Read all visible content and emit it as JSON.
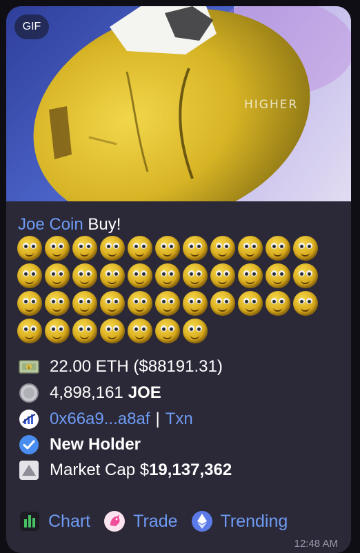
{
  "media": {
    "badge": "GIF",
    "overlay_text": "HIGHER"
  },
  "message": {
    "coin_name": "Joe Coin",
    "title_suffix": "Buy!",
    "emoji_rows": [
      11,
      11,
      11,
      7
    ],
    "emoji_icon": "nervous-smiley-icon",
    "lines": {
      "eth_amount": "22.00 ETH ($88191.31)",
      "token_amount": "4,898,161",
      "token_symbol": "JOE",
      "buyer_address": "0x66a9...a8af",
      "separator": "|",
      "txn_label": "Txn",
      "holder_status": "New Holder",
      "market_cap_label": "Market Cap $",
      "market_cap_value": "19,137,362"
    },
    "buttons": {
      "chart": "Chart",
      "trade": "Trade",
      "trending": "Trending"
    },
    "timestamp": "12:48 AM"
  },
  "colors": {
    "bubble": "#2b2937",
    "link": "#6e9bf4",
    "text": "#ffffff",
    "timestamp": "#9a97ab"
  }
}
